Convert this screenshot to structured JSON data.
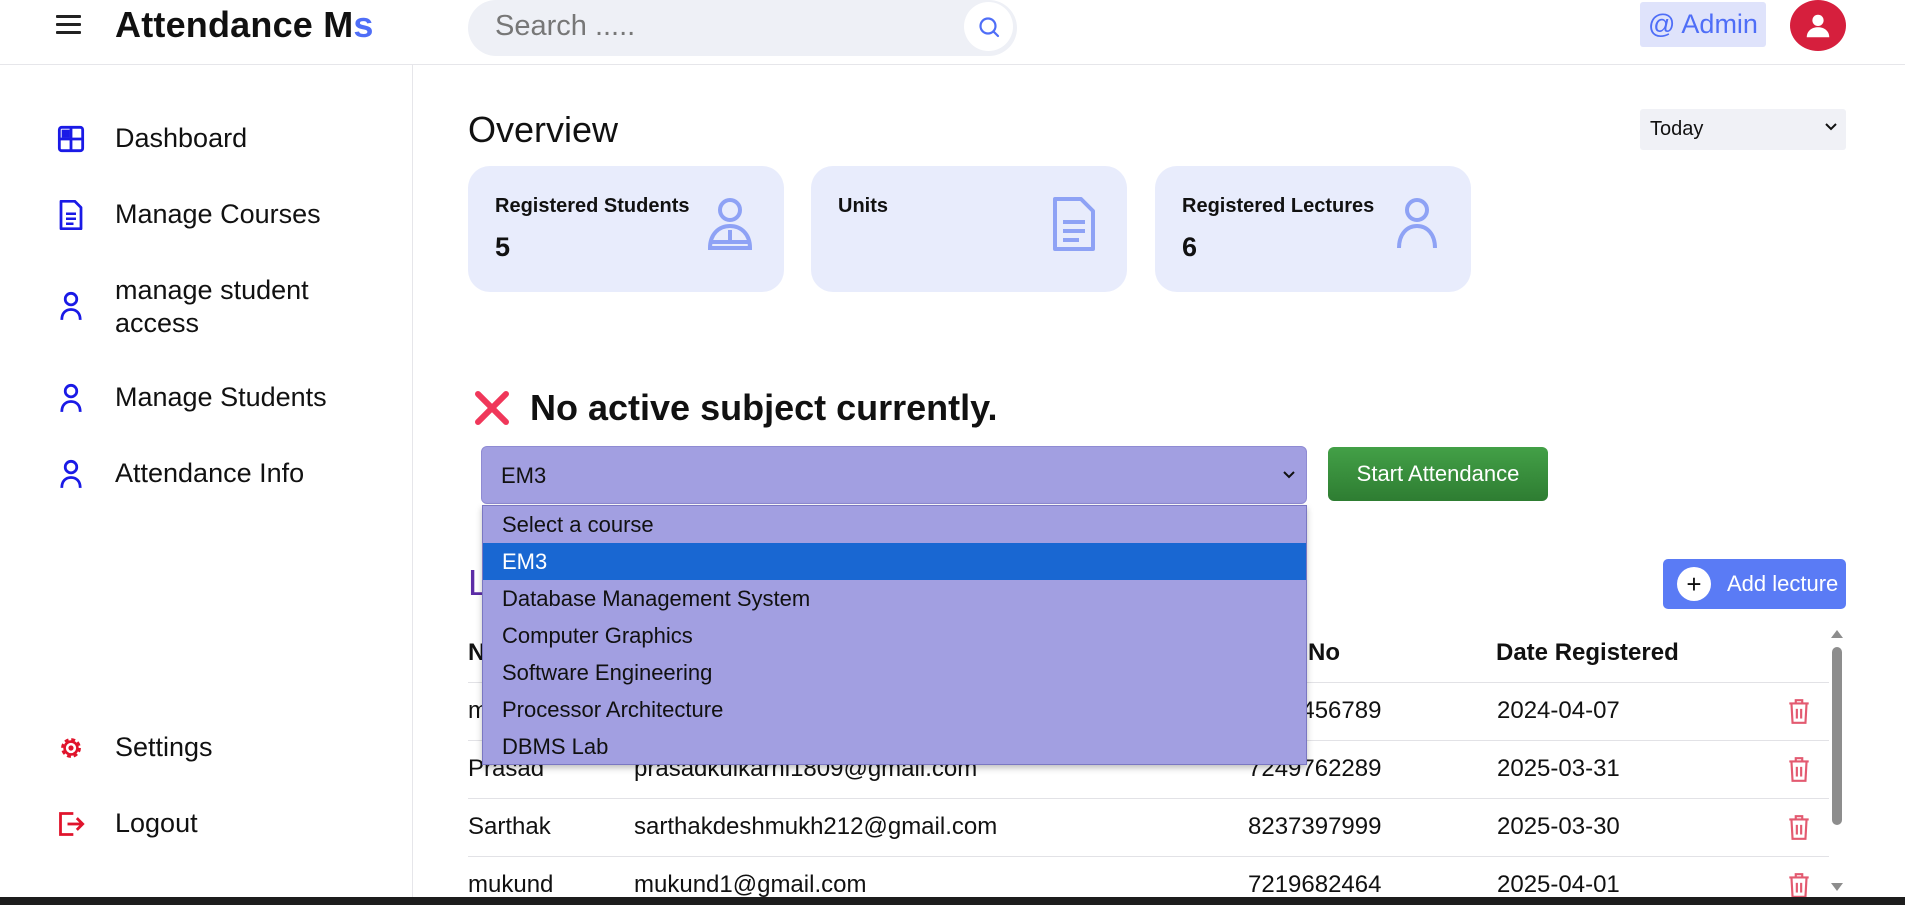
{
  "header": {
    "brand_main": "Attendance M",
    "brand_accent": "s",
    "search_placeholder": "Search .....",
    "admin_label": "@ Admin"
  },
  "sidebar": {
    "items": [
      {
        "label": "Dashboard",
        "icon": "dashboard-grid-icon"
      },
      {
        "label": "Manage Courses",
        "icon": "document-icon"
      },
      {
        "label": "manage student access",
        "icon": "user-icon"
      },
      {
        "label": "Manage Students",
        "icon": "user-icon"
      },
      {
        "label": "Attendance Info",
        "icon": "user-icon"
      }
    ],
    "bottom_items": [
      {
        "label": "Settings",
        "icon": "gear-icon"
      },
      {
        "label": "Logout",
        "icon": "logout-icon"
      }
    ]
  },
  "overview": {
    "title": "Overview",
    "period_selected": "Today",
    "cards": [
      {
        "title": "Registered Students",
        "value": "5",
        "icon": "student-icon"
      },
      {
        "title": "Units",
        "value": "",
        "icon": "document-icon"
      },
      {
        "title": "Registered Lectures",
        "value": "6",
        "icon": "user-icon"
      }
    ]
  },
  "attendance": {
    "status_text": "No active subject currently.",
    "course_selected": "EM3",
    "start_label": "Start Attendance",
    "course_options": [
      "Select a course",
      "EM3",
      "Database Management System",
      "Computer Graphics",
      "Software Engineering",
      "Processor Architecture",
      "DBMS Lab"
    ],
    "highlighted_option": "EM3"
  },
  "lectures": {
    "heading": "L",
    "add_label": "Add lecture",
    "columns": [
      "N",
      "",
      "e No",
      "Date Registered"
    ],
    "rows": [
      {
        "name": "m",
        "email": "",
        "phone": "3456789",
        "date": "2024-04-07"
      },
      {
        "name": "Prasad",
        "email": "prasadkulkarni1809@gmail.com",
        "phone": "7249762289",
        "date": "2025-03-31"
      },
      {
        "name": "Sarthak",
        "email": "sarthakdeshmukh212@gmail.com",
        "phone": "8237397999",
        "date": "2025-03-30"
      },
      {
        "name": "mukund",
        "email": "mukund1@gmail.com",
        "phone": "7219682464",
        "date": "2025-04-01"
      }
    ]
  },
  "colors": {
    "accent": "#4f6ef7",
    "card_bg": "#e8ecfc",
    "select_bg": "#a29fe1",
    "start_green": "#43a047",
    "danger": "#e0364f"
  }
}
